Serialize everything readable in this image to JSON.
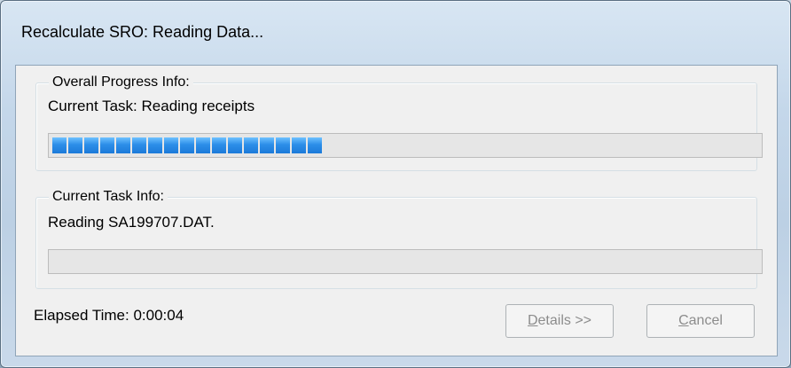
{
  "window": {
    "title": "Recalculate SRO: Reading Data..."
  },
  "overall": {
    "legend": "Overall Progress Info:",
    "task_text": "Current Task: Reading receipts",
    "progress_fraction": 0.39,
    "progress_segments": 18
  },
  "task": {
    "legend": "Current Task Info:",
    "detail_text": "Reading SA199707.DAT.",
    "progress_fraction": 0
  },
  "footer": {
    "elapsed": "Elapsed Time: 0:00:04",
    "details_button": {
      "accel": "D",
      "rest": "etails >>",
      "enabled": false
    },
    "cancel_button": {
      "accel": "C",
      "rest": "ancel",
      "enabled": false
    }
  },
  "colors": {
    "progress_fill": "#2c8ee8",
    "disabled_text": "#8c8c8c"
  }
}
